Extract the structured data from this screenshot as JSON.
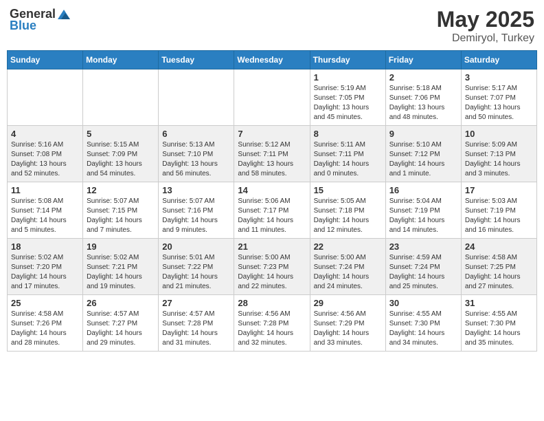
{
  "header": {
    "logo_general": "General",
    "logo_blue": "Blue",
    "title": "May 2025",
    "location": "Demiryol, Turkey"
  },
  "weekdays": [
    "Sunday",
    "Monday",
    "Tuesday",
    "Wednesday",
    "Thursday",
    "Friday",
    "Saturday"
  ],
  "weeks": [
    [
      {
        "day": "",
        "info": ""
      },
      {
        "day": "",
        "info": ""
      },
      {
        "day": "",
        "info": ""
      },
      {
        "day": "",
        "info": ""
      },
      {
        "day": "1",
        "info": "Sunrise: 5:19 AM\nSunset: 7:05 PM\nDaylight: 13 hours\nand 45 minutes."
      },
      {
        "day": "2",
        "info": "Sunrise: 5:18 AM\nSunset: 7:06 PM\nDaylight: 13 hours\nand 48 minutes."
      },
      {
        "day": "3",
        "info": "Sunrise: 5:17 AM\nSunset: 7:07 PM\nDaylight: 13 hours\nand 50 minutes."
      }
    ],
    [
      {
        "day": "4",
        "info": "Sunrise: 5:16 AM\nSunset: 7:08 PM\nDaylight: 13 hours\nand 52 minutes."
      },
      {
        "day": "5",
        "info": "Sunrise: 5:15 AM\nSunset: 7:09 PM\nDaylight: 13 hours\nand 54 minutes."
      },
      {
        "day": "6",
        "info": "Sunrise: 5:13 AM\nSunset: 7:10 PM\nDaylight: 13 hours\nand 56 minutes."
      },
      {
        "day": "7",
        "info": "Sunrise: 5:12 AM\nSunset: 7:11 PM\nDaylight: 13 hours\nand 58 minutes."
      },
      {
        "day": "8",
        "info": "Sunrise: 5:11 AM\nSunset: 7:11 PM\nDaylight: 14 hours\nand 0 minutes."
      },
      {
        "day": "9",
        "info": "Sunrise: 5:10 AM\nSunset: 7:12 PM\nDaylight: 14 hours\nand 1 minute."
      },
      {
        "day": "10",
        "info": "Sunrise: 5:09 AM\nSunset: 7:13 PM\nDaylight: 14 hours\nand 3 minutes."
      }
    ],
    [
      {
        "day": "11",
        "info": "Sunrise: 5:08 AM\nSunset: 7:14 PM\nDaylight: 14 hours\nand 5 minutes."
      },
      {
        "day": "12",
        "info": "Sunrise: 5:07 AM\nSunset: 7:15 PM\nDaylight: 14 hours\nand 7 minutes."
      },
      {
        "day": "13",
        "info": "Sunrise: 5:07 AM\nSunset: 7:16 PM\nDaylight: 14 hours\nand 9 minutes."
      },
      {
        "day": "14",
        "info": "Sunrise: 5:06 AM\nSunset: 7:17 PM\nDaylight: 14 hours\nand 11 minutes."
      },
      {
        "day": "15",
        "info": "Sunrise: 5:05 AM\nSunset: 7:18 PM\nDaylight: 14 hours\nand 12 minutes."
      },
      {
        "day": "16",
        "info": "Sunrise: 5:04 AM\nSunset: 7:19 PM\nDaylight: 14 hours\nand 14 minutes."
      },
      {
        "day": "17",
        "info": "Sunrise: 5:03 AM\nSunset: 7:19 PM\nDaylight: 14 hours\nand 16 minutes."
      }
    ],
    [
      {
        "day": "18",
        "info": "Sunrise: 5:02 AM\nSunset: 7:20 PM\nDaylight: 14 hours\nand 17 minutes."
      },
      {
        "day": "19",
        "info": "Sunrise: 5:02 AM\nSunset: 7:21 PM\nDaylight: 14 hours\nand 19 minutes."
      },
      {
        "day": "20",
        "info": "Sunrise: 5:01 AM\nSunset: 7:22 PM\nDaylight: 14 hours\nand 21 minutes."
      },
      {
        "day": "21",
        "info": "Sunrise: 5:00 AM\nSunset: 7:23 PM\nDaylight: 14 hours\nand 22 minutes."
      },
      {
        "day": "22",
        "info": "Sunrise: 5:00 AM\nSunset: 7:24 PM\nDaylight: 14 hours\nand 24 minutes."
      },
      {
        "day": "23",
        "info": "Sunrise: 4:59 AM\nSunset: 7:24 PM\nDaylight: 14 hours\nand 25 minutes."
      },
      {
        "day": "24",
        "info": "Sunrise: 4:58 AM\nSunset: 7:25 PM\nDaylight: 14 hours\nand 27 minutes."
      }
    ],
    [
      {
        "day": "25",
        "info": "Sunrise: 4:58 AM\nSunset: 7:26 PM\nDaylight: 14 hours\nand 28 minutes."
      },
      {
        "day": "26",
        "info": "Sunrise: 4:57 AM\nSunset: 7:27 PM\nDaylight: 14 hours\nand 29 minutes."
      },
      {
        "day": "27",
        "info": "Sunrise: 4:57 AM\nSunset: 7:28 PM\nDaylight: 14 hours\nand 31 minutes."
      },
      {
        "day": "28",
        "info": "Sunrise: 4:56 AM\nSunset: 7:28 PM\nDaylight: 14 hours\nand 32 minutes."
      },
      {
        "day": "29",
        "info": "Sunrise: 4:56 AM\nSunset: 7:29 PM\nDaylight: 14 hours\nand 33 minutes."
      },
      {
        "day": "30",
        "info": "Sunrise: 4:55 AM\nSunset: 7:30 PM\nDaylight: 14 hours\nand 34 minutes."
      },
      {
        "day": "31",
        "info": "Sunrise: 4:55 AM\nSunset: 7:30 PM\nDaylight: 14 hours\nand 35 minutes."
      }
    ]
  ]
}
